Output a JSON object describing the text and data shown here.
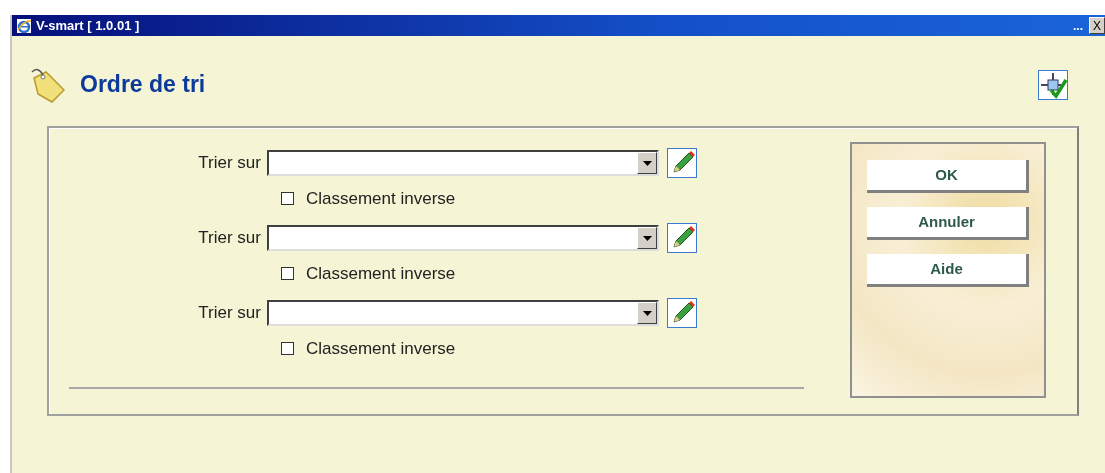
{
  "window": {
    "title": "V-smart [ 1.0.01 ]",
    "title_bar_controls": [
      "...",
      "X"
    ]
  },
  "page": {
    "title": "Ordre de tri"
  },
  "sort_rows": [
    {
      "label": "Trier sur",
      "value": "",
      "checkbox": {
        "label": "Classement inverse",
        "checked": false
      }
    },
    {
      "label": "Trier sur",
      "value": "",
      "checkbox": {
        "label": "Classement inverse",
        "checked": false
      }
    },
    {
      "label": "Trier sur",
      "value": "",
      "checkbox": {
        "label": "Classement inverse",
        "checked": false
      }
    }
  ],
  "buttons": [
    "OK",
    "Annuler",
    "Aide"
  ]
}
